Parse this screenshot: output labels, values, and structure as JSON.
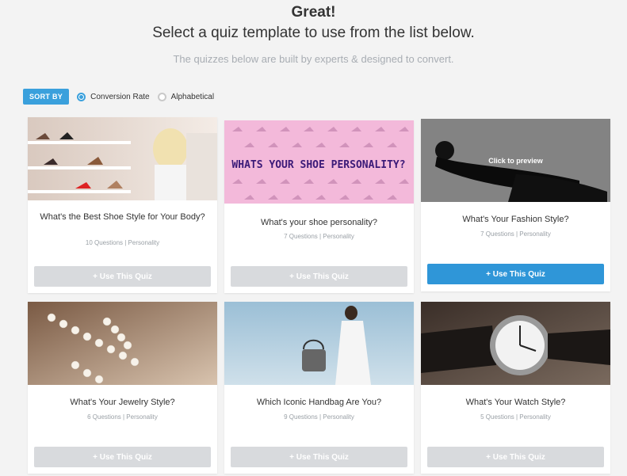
{
  "header": {
    "title": "Great!",
    "subtitle": "Select a quiz template to use from the list below.",
    "tagline": "The quizzes below are built by experts & designed to convert."
  },
  "sort": {
    "label": "SORT BY",
    "options": [
      {
        "label": "Conversion Rate",
        "selected": true
      },
      {
        "label": "Alphabetical",
        "selected": false
      }
    ]
  },
  "quizzes": [
    {
      "title": "What's the Best Shoe Style for Your Body?",
      "meta": "10 Questions | Personality",
      "button": "+ Use This Quiz"
    },
    {
      "title": "What's your shoe personality?",
      "meta": "7 Questions | Personality",
      "button": "+ Use This Quiz",
      "image_text": "WHATS YOUR SHOE PERSONALITY?"
    },
    {
      "title": "What's Your Fashion Style?",
      "meta": "7 Questions | Personality",
      "button": "+ Use This Quiz",
      "overlay": "Click to preview",
      "active": true
    },
    {
      "title": "What's Your Jewelry Style?",
      "meta": "6 Questions | Personality",
      "button": "+ Use This Quiz"
    },
    {
      "title": "Which Iconic Handbag Are You?",
      "meta": "9 Questions | Personality",
      "button": "+ Use This Quiz"
    },
    {
      "title": "What's Your Watch Style?",
      "meta": "5 Questions | Personality",
      "button": "+ Use This Quiz"
    }
  ],
  "colors": {
    "accent": "#3aa0dc",
    "button_disabled": "#d8dadd",
    "button_active": "#2f96d8",
    "background": "#f3f3f3"
  }
}
